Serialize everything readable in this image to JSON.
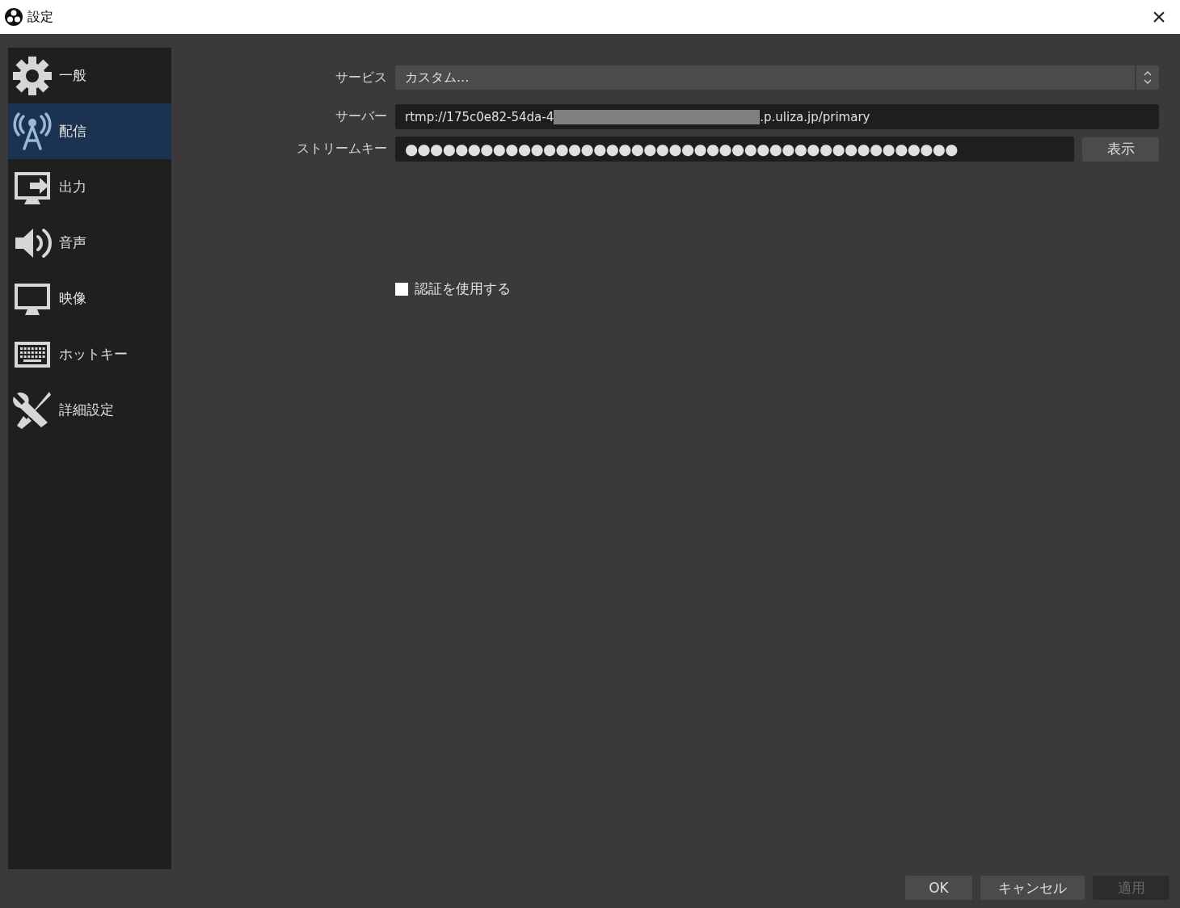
{
  "window": {
    "title": "設定",
    "close": "×"
  },
  "sidebar": {
    "items": [
      {
        "kind": "gear",
        "label": "一般",
        "selected": false
      },
      {
        "kind": "antenna",
        "label": "配信",
        "selected": true
      },
      {
        "kind": "output",
        "label": "出力",
        "selected": false
      },
      {
        "kind": "speaker",
        "label": "音声",
        "selected": false
      },
      {
        "kind": "monitor",
        "label": "映像",
        "selected": false
      },
      {
        "kind": "keyboard",
        "label": "ホットキー",
        "selected": false
      },
      {
        "kind": "tools",
        "label": "詳細設定",
        "selected": false
      }
    ]
  },
  "form": {
    "service": {
      "label": "サービス",
      "value": "カスタム..."
    },
    "server": {
      "label": "サーバー",
      "value_start": "rtmp://175c0e82-54da-4",
      "value_end": ".p.uliza.jp/primary",
      "redacted": true
    },
    "stream_key": {
      "label": "ストリームキー",
      "value": "●●●●●●●●●●●●●●●●●●●●●●●●●●●●●●●●●●●●●●●●●●●●",
      "button": "表示"
    },
    "auth": {
      "label": "認証を使用する",
      "checked": false
    }
  },
  "buttons": [
    {
      "label": "OK",
      "disabled": false
    },
    {
      "label": "キャンセル",
      "disabled": false
    },
    {
      "label": "適用",
      "disabled": true
    }
  ]
}
